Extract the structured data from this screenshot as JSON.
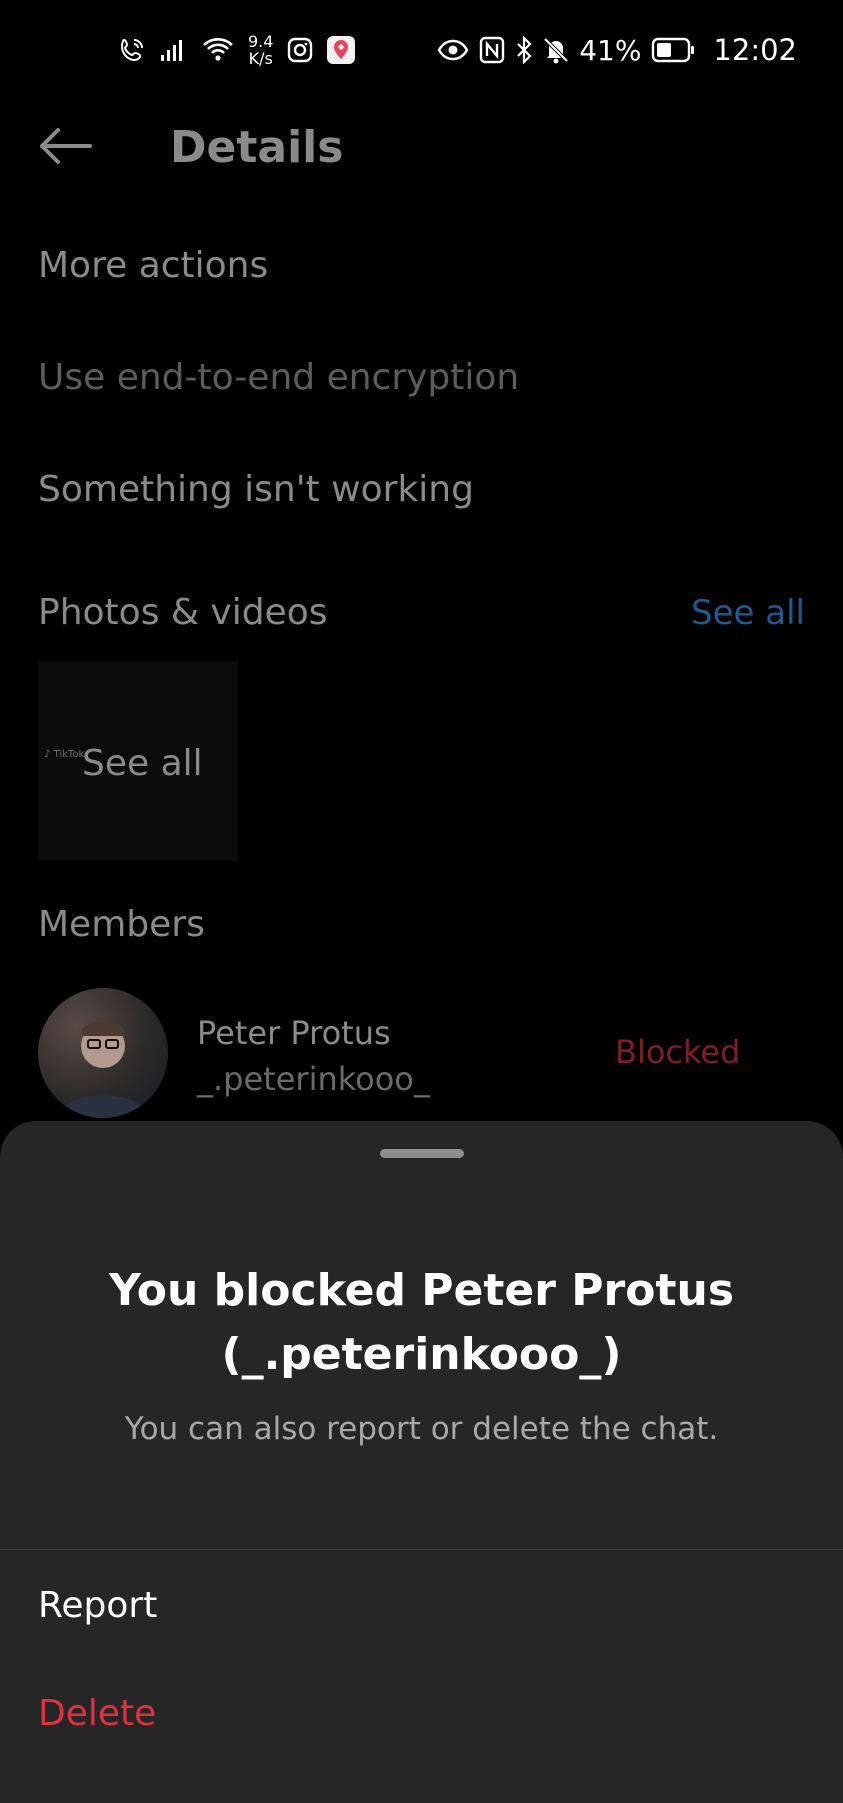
{
  "status_bar": {
    "net_speed_value": "9.4",
    "net_speed_unit": "K/s",
    "battery": "41%",
    "time": "12:02"
  },
  "header": {
    "title": "Details",
    "back_icon": "arrow-left-icon"
  },
  "more_actions": {
    "label": "More actions",
    "items": [
      {
        "label": "Use end-to-end encryption"
      },
      {
        "label": "Something isn't working"
      }
    ]
  },
  "media": {
    "label": "Photos & videos",
    "see_all": "See all",
    "thumb_label": "See all",
    "thumb_watermark": "TikTok"
  },
  "members": {
    "label": "Members",
    "items": [
      {
        "name": "Peter Protus",
        "handle": "_.peterinkooo_",
        "status": "Blocked"
      }
    ]
  },
  "sheet": {
    "title": "You blocked Peter Protus (_.peterinkooo_)",
    "subtitle": "You can also report or delete the chat.",
    "report": "Report",
    "delete": "Delete"
  },
  "colors": {
    "background": "#000000",
    "sheet": "#262626",
    "link": "#1d5a90",
    "blocked": "#7d1f24",
    "delete": "#e0313f"
  }
}
